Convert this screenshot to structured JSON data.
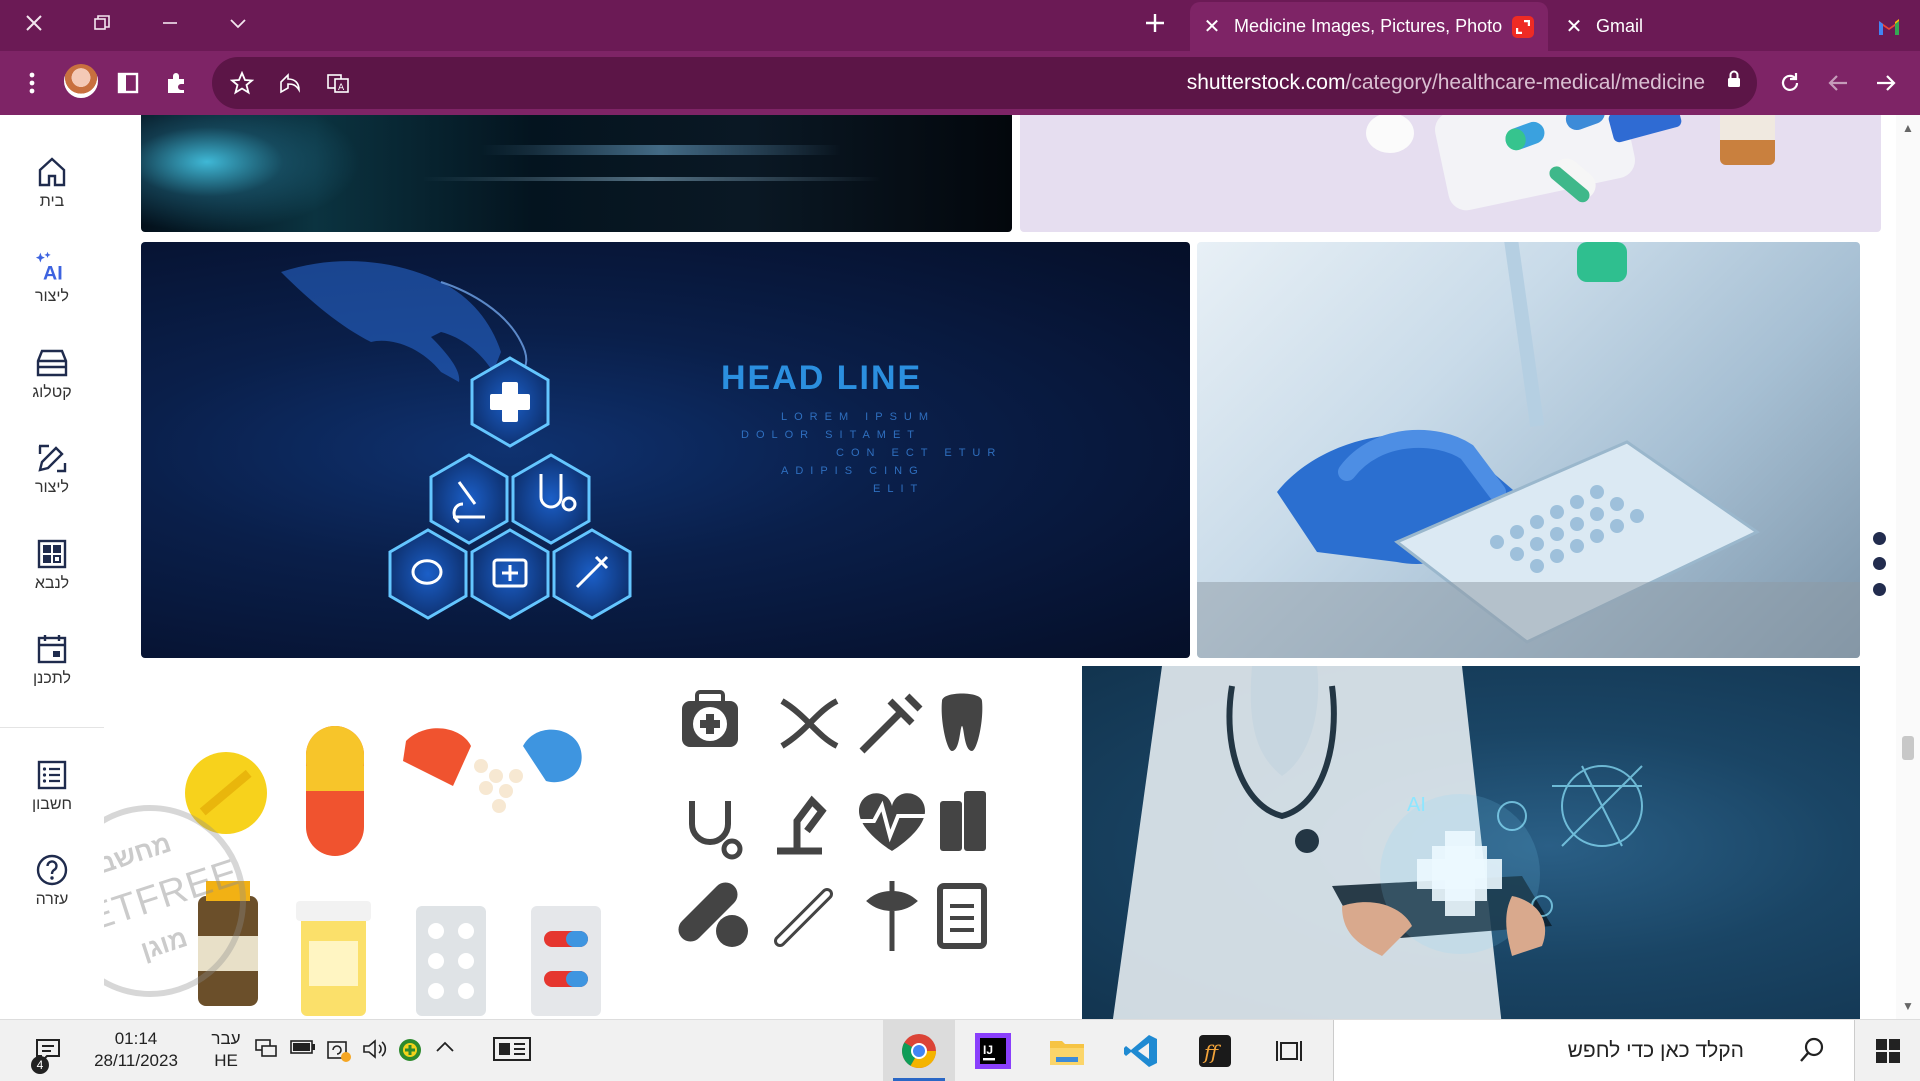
{
  "browser": {
    "tabs": [
      {
        "title": "Medicine Images, Pictures, Photos",
        "active": true
      },
      {
        "title": "Gmail",
        "active": false
      }
    ],
    "address": {
      "host": "shutterstock.com",
      "path": "/category/healthcare-medical/medicine"
    }
  },
  "sidenav": {
    "items": [
      {
        "label": "בית",
        "icon": "home-icon"
      },
      {
        "label": "ליצור",
        "icon": "ai-generate-icon",
        "badge": "AI"
      },
      {
        "label": "קטלוג",
        "icon": "catalog-icon"
      },
      {
        "label": "ליצור",
        "icon": "edit-create-icon"
      },
      {
        "label": "לנבא",
        "icon": "predict-grid-icon"
      },
      {
        "label": "לתכנן",
        "icon": "calendar-plan-icon"
      },
      {
        "label": "חשבון",
        "icon": "account-list-icon"
      },
      {
        "label": "עזרה",
        "icon": "help-icon"
      }
    ]
  },
  "tiles": {
    "headline": {
      "title": "HEAD LINE",
      "lines": [
        "LOREM IPSUM",
        "DOLOR SITAMET",
        "CON ECT ETUR",
        "ADIPIS CING",
        "ELIT"
      ]
    },
    "doctor_ai_label": "AI"
  },
  "watermark": {
    "top": "מחשב",
    "middle": "NETFREE",
    "bottom": "מוגן"
  },
  "taskbar": {
    "search_placeholder": "הקלד כאן כדי לחפש",
    "time": "01:14",
    "date": "28/11/2023",
    "lang_top": "עבר",
    "lang_bottom": "HE",
    "notification_count": "4"
  },
  "colors": {
    "tabbar": "#6b1a55",
    "toolbar": "#7e2466",
    "accent_blue": "#2a67c5"
  }
}
